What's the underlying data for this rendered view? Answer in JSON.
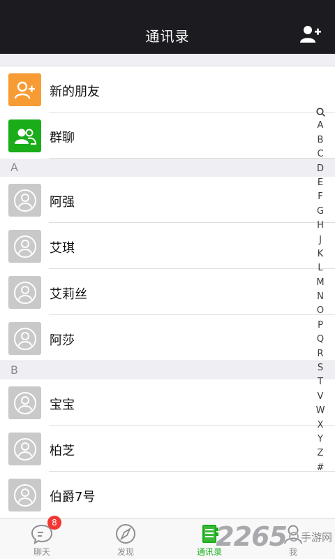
{
  "header": {
    "title": "通讯录",
    "add_icon": "add-contact-icon"
  },
  "special_rows": [
    {
      "label": "新的朋友",
      "icon": "new-friend-icon",
      "color": "#f79c35"
    },
    {
      "label": "群聊",
      "icon": "group-chat-icon",
      "color": "#1aad19"
    }
  ],
  "sections": [
    {
      "letter": "A",
      "contacts": [
        "阿强",
        "艾琪",
        "艾莉丝",
        "阿莎"
      ]
    },
    {
      "letter": "B",
      "contacts": [
        "宝宝",
        "柏芝",
        "伯爵7号"
      ]
    }
  ],
  "index_letters": [
    "Q",
    "A",
    "B",
    "C",
    "D",
    "E",
    "F",
    "G",
    "H",
    "J",
    "K",
    "L",
    "M",
    "N",
    "O",
    "P",
    "Q",
    "R",
    "S",
    "T",
    "V",
    "W",
    "X",
    "Y",
    "Z",
    "#"
  ],
  "tabs": [
    {
      "label": "聊天",
      "icon": "chat-bubble-icon",
      "badge": "8"
    },
    {
      "label": "发现",
      "icon": "compass-icon"
    },
    {
      "label": "通讯录",
      "icon": "contacts-book-icon",
      "active": true
    },
    {
      "label": "我",
      "icon": "person-icon"
    }
  ],
  "watermark": {
    "number": "2265",
    "text": "手游网"
  },
  "colors": {
    "accent": "#1aad19",
    "header": "#1c1b20",
    "badge": "#f43531"
  }
}
